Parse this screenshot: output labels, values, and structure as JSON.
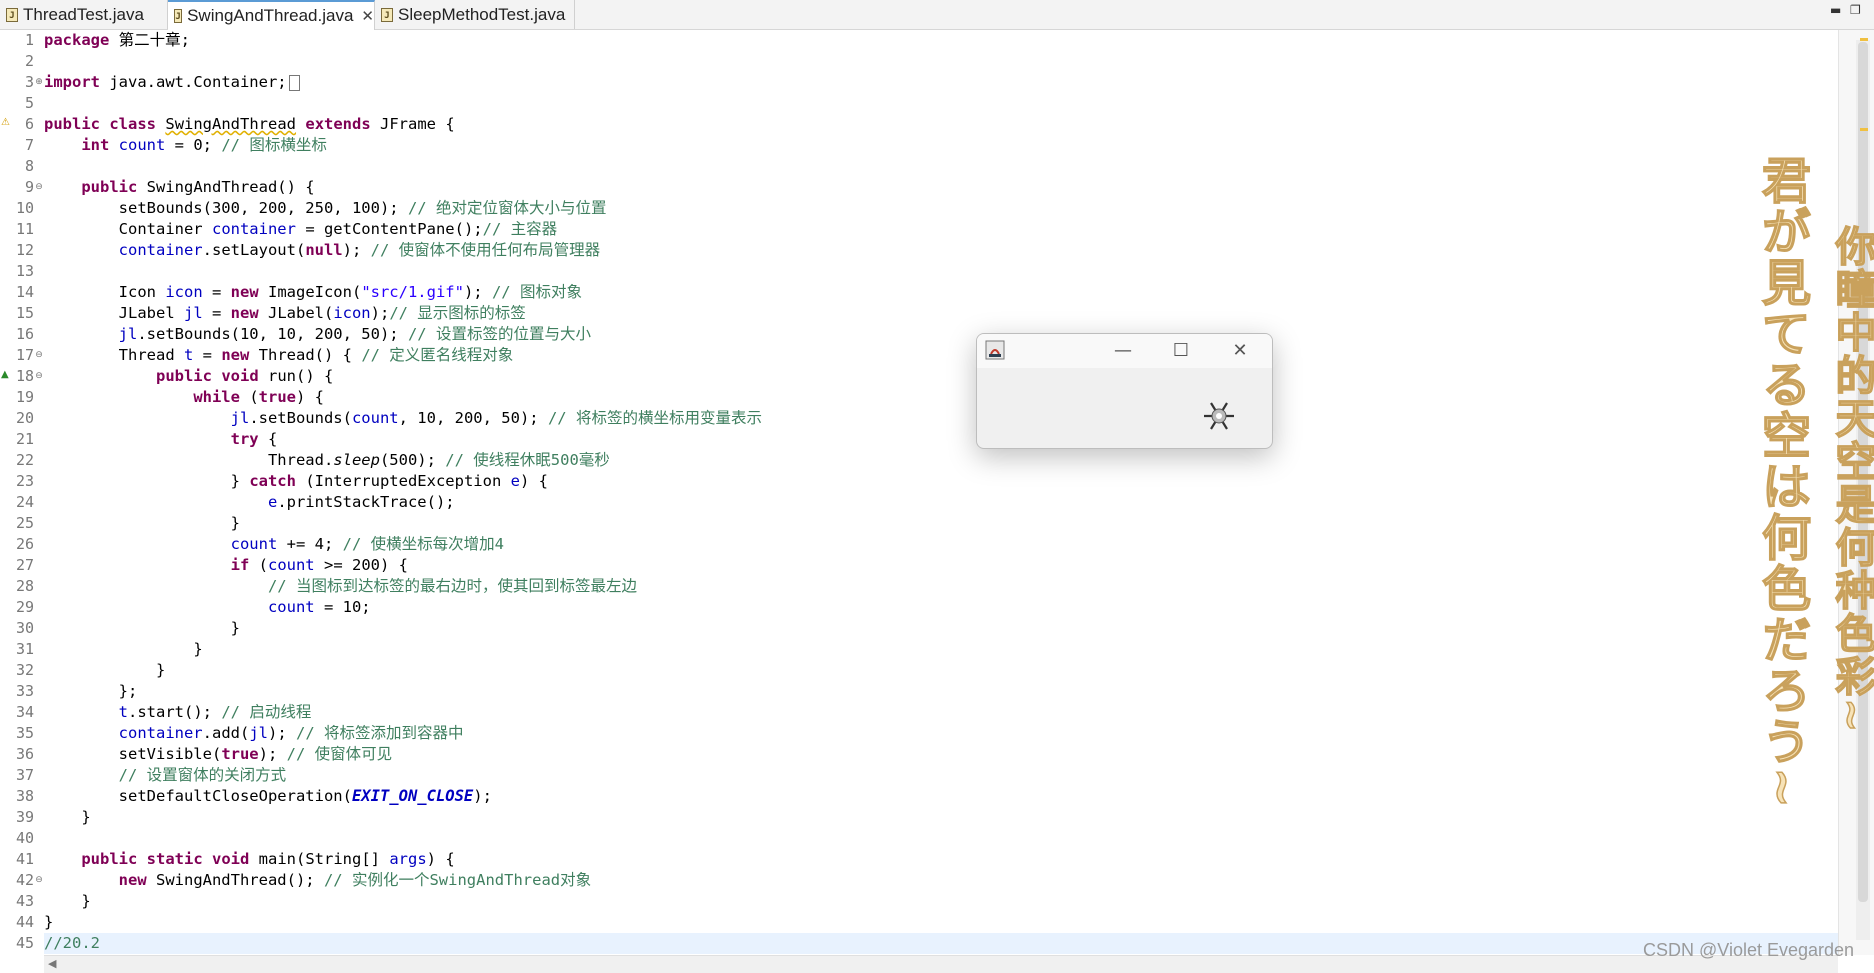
{
  "tabs": [
    {
      "label": "ThreadTest.java",
      "active": false
    },
    {
      "label": "SwingAndThread.java",
      "active": true
    },
    {
      "label": "SleepMethodTest.java",
      "active": false
    }
  ],
  "tab_close_glyph": "✕",
  "window_controls": {
    "minimize": "▬",
    "restore": "❐"
  },
  "line_numbers": [
    "1",
    "2",
    "3",
    "5",
    "6",
    "7",
    "8",
    "9",
    "10",
    "11",
    "12",
    "13",
    "14",
    "15",
    "16",
    "17",
    "18",
    "19",
    "20",
    "21",
    "22",
    "23",
    "24",
    "25",
    "26",
    "27",
    "28",
    "29",
    "30",
    "31",
    "32",
    "33",
    "34",
    "35",
    "36",
    "37",
    "38",
    "39",
    "40",
    "41",
    "42",
    "43",
    "44",
    "45"
  ],
  "code": {
    "l1": {
      "kw": "package",
      "rest": " 第二十章;"
    },
    "l3": {
      "kw": "import",
      "rest": " java.awt.Container;"
    },
    "l6": {
      "kw1": "public",
      "kw2": "class",
      "name": "SwingAndThread",
      "kw3": "extends",
      "rest": " JFrame {"
    },
    "l7": {
      "kw": "int",
      "field": "count",
      "rest": " = 0; ",
      "comment": "// 图标横坐标"
    },
    "l9": {
      "kw": "public",
      "rest": " SwingAndThread() {"
    },
    "l10": {
      "code": "setBounds(300, 200, 250, 100); ",
      "comment": "// 绝对定位窗体大小与位置"
    },
    "l11": {
      "pre": "Container ",
      "field": "container",
      "rest": " = getContentPane();",
      "comment": "// 主容器"
    },
    "l12": {
      "field": "container",
      "pre": ".setLayout(",
      "kw": "null",
      "rest": "); ",
      "comment": "// 使窗体不使用任何布局管理器"
    },
    "l14": {
      "pre": "Icon ",
      "field": "icon",
      "mid": " = ",
      "kw": "new",
      "rest1": " ImageIcon(",
      "str": "\"src/1.gif\"",
      "rest2": "); ",
      "comment": "// 图标对象"
    },
    "l15": {
      "pre": "JLabel ",
      "field": "jl",
      "mid": " = ",
      "kw": "new",
      "rest1": " JLabel(",
      "field2": "icon",
      "rest2": ");",
      "comment": "// 显示图标的标签"
    },
    "l16": {
      "field": "jl",
      "rest": ".setBounds(10, 10, 200, 50); ",
      "comment": "// 设置标签的位置与大小"
    },
    "l17": {
      "pre": "Thread ",
      "field": "t",
      "mid": " = ",
      "kw": "new",
      "rest": " Thread() { ",
      "comment": "// 定义匿名线程对象"
    },
    "l18": {
      "kw1": "public",
      "kw2": "void",
      "rest": " run() {"
    },
    "l19": {
      "kw1": "while",
      "mid": " (",
      "kw2": "true",
      "rest": ") {"
    },
    "l20": {
      "field": "jl",
      "pre": ".setBounds(",
      "field2": "count",
      "rest": ", 10, 200, 50); ",
      "comment": "// 将标签的横坐标用变量表示"
    },
    "l21": {
      "kw": "try",
      "rest": " {"
    },
    "l22": {
      "pre": "Thread.",
      "ital": "sleep",
      "rest": "(500); ",
      "comment": "// 使线程休眠500毫秒"
    },
    "l23": {
      "pre": "} ",
      "kw": "catch",
      "rest": " (InterruptedException ",
      "field": "e",
      "rest2": ") {"
    },
    "l24": {
      "field": "e",
      "rest": ".printStackTrace();"
    },
    "l25": {
      "code": "}"
    },
    "l26": {
      "field": "count",
      "rest": " += 4; ",
      "comment": "// 使横坐标每次增加4"
    },
    "l27": {
      "kw": "if",
      "mid": " (",
      "field": "count",
      "rest": " >= 200) {"
    },
    "l28": {
      "comment": "// 当图标到达标签的最右边时，使其回到标签最左边"
    },
    "l29": {
      "field": "count",
      "rest": " = 10;"
    },
    "l30": {
      "code": "}"
    },
    "l31": {
      "code": "}"
    },
    "l32": {
      "code": "}"
    },
    "l33": {
      "code": "};"
    },
    "l34": {
      "field": "t",
      "rest": ".start(); ",
      "comment": "// 启动线程"
    },
    "l35": {
      "field": "container",
      "pre": ".add(",
      "field2": "jl",
      "rest": "); ",
      "comment": "// 将标签添加到容器中"
    },
    "l36": {
      "pre": "setVisible(",
      "kw": "true",
      "rest": "); ",
      "comment": "// 使窗体可见"
    },
    "l37": {
      "comment": "// 设置窗体的关闭方式"
    },
    "l38": {
      "pre": "setDefaultCloseOperation(",
      "cst": "EXIT_ON_CLOSE",
      "rest": ");"
    },
    "l39": {
      "code": "}"
    },
    "l41": {
      "kw1": "public",
      "kw2": "static",
      "kw3": "void",
      "pre": " main(String[] ",
      "field": "args",
      "rest": ") {"
    },
    "l42": {
      "kw": "new",
      "rest": " SwingAndThread(); ",
      "comment": "// 实例化一个SwingAndThread对象"
    },
    "l43": {
      "code": "}"
    },
    "l44": {
      "code": "}"
    },
    "l45": {
      "comment": "//20.2"
    }
  },
  "swing_window": {
    "minimize_glyph": "—",
    "maximize_glyph": "☐",
    "close_glyph": "✕"
  },
  "decor_text": {
    "line1": "君が見てる空は何色だろう~",
    "line2": "你瞳中的天空是何种色彩~"
  },
  "watermark": "CSDN @Violet Evegarden",
  "colors": {
    "keyword": "#7f0055",
    "field": "#0000c0",
    "comment": "#3f7f5f",
    "string": "#2a00ff",
    "current_line": "#e8f2fe"
  }
}
